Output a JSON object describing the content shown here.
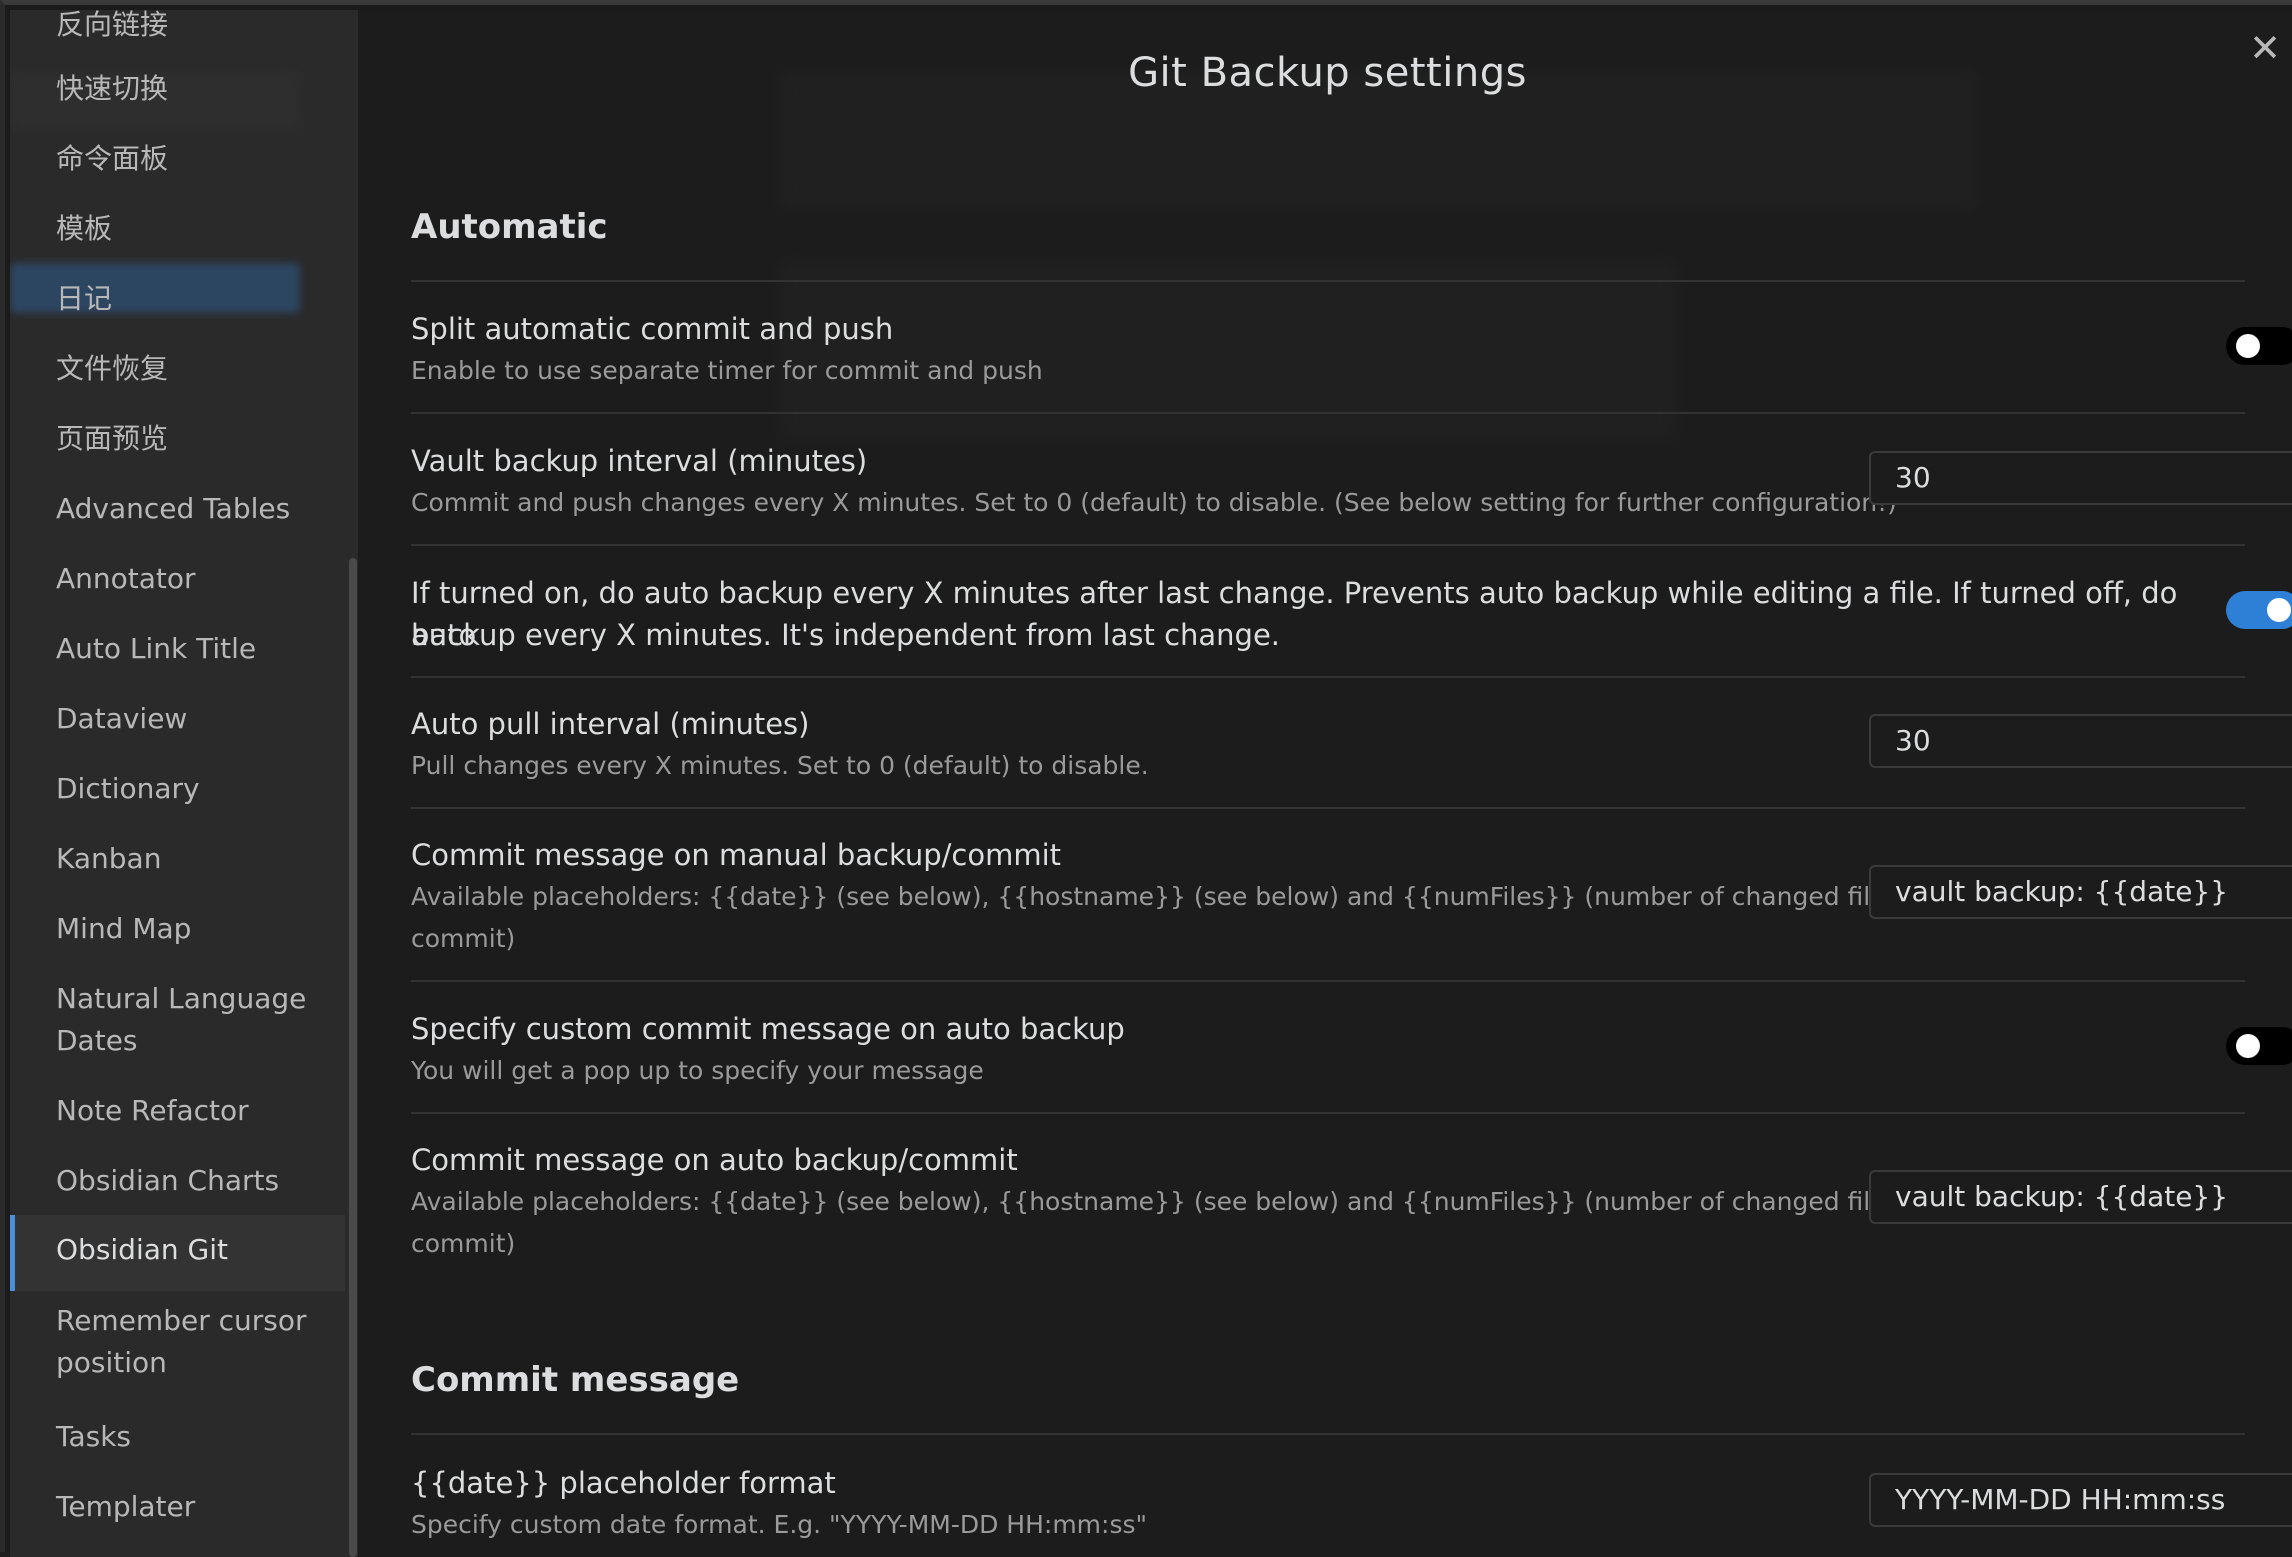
{
  "sidebar": {
    "items": [
      {
        "label": "反向链接"
      },
      {
        "label": "快速切换"
      },
      {
        "label": "命令面板"
      },
      {
        "label": "模板"
      },
      {
        "label": "日记"
      },
      {
        "label": "文件恢复"
      },
      {
        "label": "页面预览"
      },
      {
        "label": "Advanced Tables"
      },
      {
        "label": "Annotator"
      },
      {
        "label": "Auto Link Title"
      },
      {
        "label": "Dataview"
      },
      {
        "label": "Dictionary"
      },
      {
        "label": "Kanban"
      },
      {
        "label": "Mind Map"
      },
      {
        "label": "Natural Language Dates"
      },
      {
        "label": "Note Refactor"
      },
      {
        "label": "Obsidian Charts"
      },
      {
        "label": "Obsidian Git",
        "active": true
      },
      {
        "label": "Remember cursor position"
      },
      {
        "label": "Tasks"
      },
      {
        "label": "Templater"
      }
    ]
  },
  "modal": {
    "title": "Git Backup settings",
    "close_icon": "close-icon"
  },
  "sections": {
    "automatic": {
      "heading": "Automatic",
      "split_commit_push": {
        "name": "Split automatic commit and push",
        "desc": "Enable to use separate timer for commit and push",
        "enabled": false
      },
      "vault_backup_interval": {
        "name": "Vault backup interval (minutes)",
        "desc": "Commit and push changes every X minutes. Set to 0 (default) to disable. (See below setting for further configuration!)",
        "value": "30"
      },
      "auto_backup_after_change": {
        "name_line1": "If turned on, do auto backup every X minutes after last change. Prevents auto backup while editing a file. If turned off, do auto",
        "name_line2": "backup every X minutes. It's independent from last change.",
        "enabled": true
      },
      "auto_pull_interval": {
        "name": "Auto pull interval (minutes)",
        "desc": "Pull changes every X minutes. Set to 0 (default) to disable.",
        "value": "30"
      },
      "commit_msg_manual": {
        "name": "Commit message on manual backup/commit",
        "desc_line1": "Available placeholders: {{date}} (see below), {{hostname}} (see below) and {{numFiles}} (number of changed files in the",
        "desc_line2": "commit)",
        "value": "vault backup: {{date}}"
      },
      "custom_msg_auto": {
        "name": "Specify custom commit message on auto backup",
        "desc": "You will get a pop up to specify your message",
        "enabled": false
      },
      "commit_msg_auto": {
        "name": "Commit message on auto backup/commit",
        "desc_line1": "Available placeholders: {{date}} (see below), {{hostname}} (see below) and {{numFiles}} (number of changed files in the",
        "desc_line2": "commit)",
        "value": "vault backup: {{date}}"
      }
    },
    "commit_message": {
      "heading": "Commit message",
      "date_format": {
        "name": "{{date}} placeholder format",
        "desc": "Specify custom date format. E.g. \"YYYY-MM-DD HH:mm:ss\"",
        "value": "YYYY-MM-DD HH:mm:ss"
      }
    }
  },
  "colors": {
    "accent": "#2e7fd6",
    "background": "#1c1c1c",
    "sidebar": "#2a2a2a"
  }
}
